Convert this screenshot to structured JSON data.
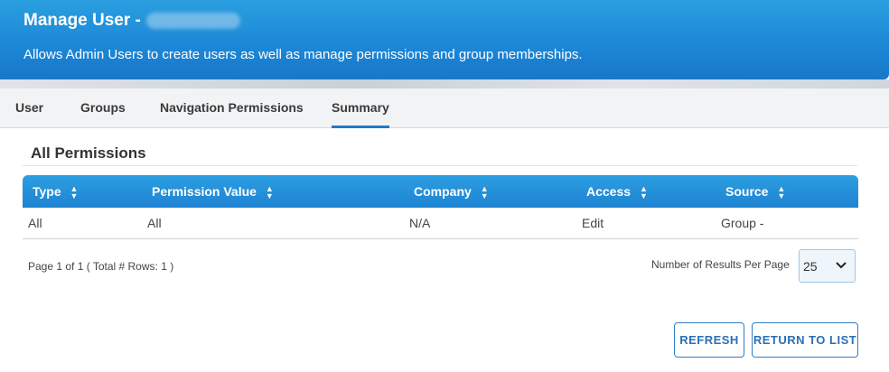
{
  "header": {
    "title": "Manage User -",
    "subtitle": "Allows Admin Users to create users as well as manage permissions and group memberships."
  },
  "tabs": [
    {
      "label": "User"
    },
    {
      "label": "Groups"
    },
    {
      "label": "Navigation Permissions"
    },
    {
      "label": "Summary",
      "active": true
    }
  ],
  "section": {
    "title": "All Permissions"
  },
  "table": {
    "columns": [
      "Type",
      "Permission Value",
      "Company",
      "Access",
      "Source"
    ],
    "rows": [
      [
        "All",
        "All",
        "N/A",
        "Edit",
        "Group -"
      ]
    ]
  },
  "pager": {
    "info": "Page 1 of 1 ( Total # Rows: 1 )",
    "per_page_label": "Number of Results Per Page",
    "per_page_value": "25"
  },
  "buttons": {
    "refresh": "REFRESH",
    "return_to_list": "RETURN TO LIST"
  },
  "colors": {
    "header_blue": "#1c86d6",
    "accent": "#2379c9"
  }
}
